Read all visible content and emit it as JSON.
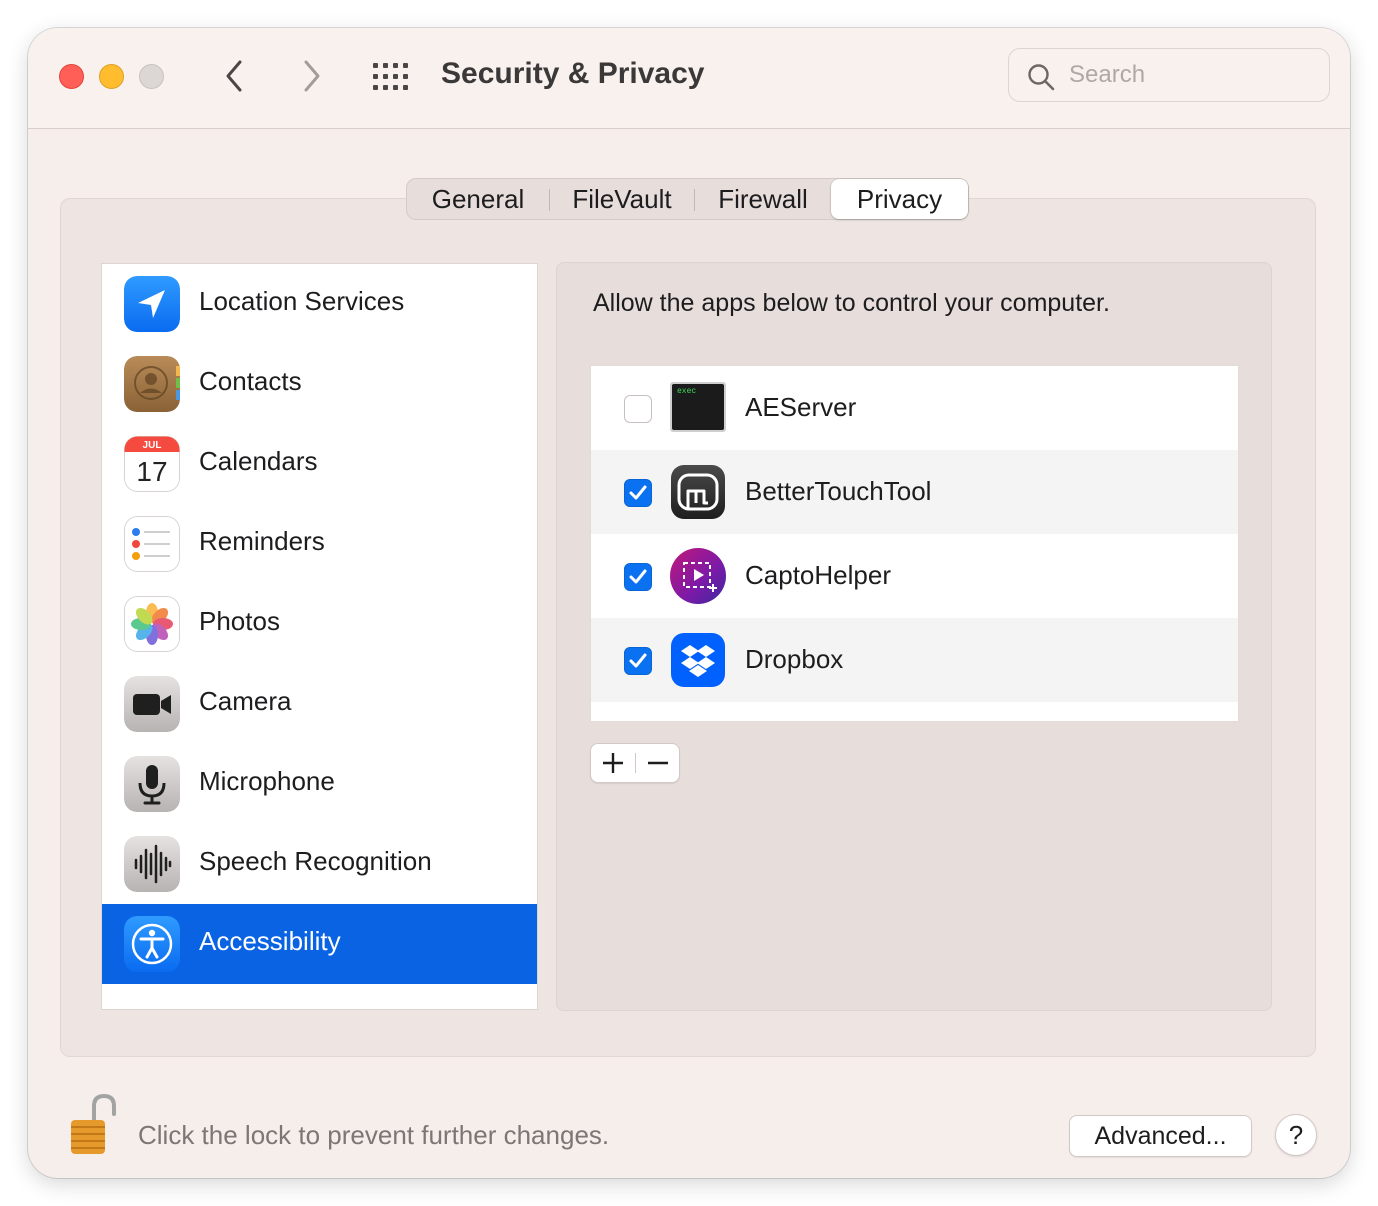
{
  "window": {
    "title": "Security & Privacy",
    "search_placeholder": "Search",
    "buttons": {
      "close": "close-icon",
      "minimize": "minimize-icon",
      "zoom": "zoom-icon",
      "back": "chevron-left-icon",
      "forward": "chevron-right-icon",
      "show_all": "grid-icon"
    }
  },
  "tabs": [
    {
      "label": "General",
      "selected": false
    },
    {
      "label": "FileVault",
      "selected": false
    },
    {
      "label": "Firewall",
      "selected": false
    },
    {
      "label": "Privacy",
      "selected": true
    }
  ],
  "sidebar": {
    "items": [
      {
        "label": "Location Services",
        "icon": "location-icon",
        "selected": false
      },
      {
        "label": "Contacts",
        "icon": "contacts-icon",
        "selected": false
      },
      {
        "label": "Calendars",
        "icon": "calendar-icon",
        "selected": false,
        "icon_month": "JUL",
        "icon_day": "17"
      },
      {
        "label": "Reminders",
        "icon": "reminders-icon",
        "selected": false
      },
      {
        "label": "Photos",
        "icon": "photos-icon",
        "selected": false
      },
      {
        "label": "Camera",
        "icon": "camera-icon",
        "selected": false
      },
      {
        "label": "Microphone",
        "icon": "microphone-icon",
        "selected": false
      },
      {
        "label": "Speech Recognition",
        "icon": "speech-recognition-icon",
        "selected": false
      },
      {
        "label": "Accessibility",
        "icon": "accessibility-icon",
        "selected": true
      }
    ]
  },
  "panel": {
    "description": "Allow the apps below to control your computer.",
    "apps": [
      {
        "name": "AEServer",
        "checked": false,
        "icon": "terminal-exec-icon",
        "icon_text": "exec"
      },
      {
        "name": "BetterTouchTool",
        "checked": true,
        "icon": "bettertouchtool-icon"
      },
      {
        "name": "CaptoHelper",
        "checked": true,
        "icon": "captohelper-icon"
      },
      {
        "name": "Dropbox",
        "checked": true,
        "icon": "dropbox-icon"
      }
    ],
    "add_label": "+",
    "remove_label": "−"
  },
  "footer": {
    "lock_text": "Click the lock to prevent further changes.",
    "advanced_label": "Advanced...",
    "help_label": "?"
  },
  "colors": {
    "accent": "#0963e3",
    "checkbox": "#0a72f0",
    "window_bg": "#f6eeeb",
    "close": "#ff5f57",
    "minimize": "#febc2e"
  }
}
